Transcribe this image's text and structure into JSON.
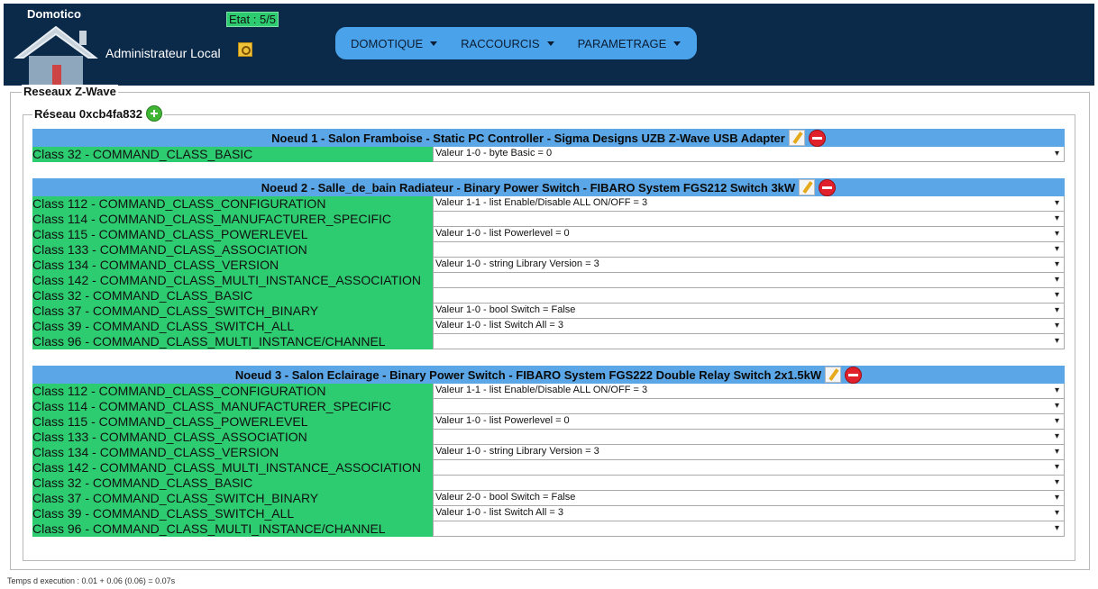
{
  "header": {
    "brand": "Domotico",
    "etat": "Etat : 5/5",
    "user": "Administrateur Local",
    "menu": [
      {
        "label": "DOMOTIQUE"
      },
      {
        "label": "RACCOURCIS"
      },
      {
        "label": "PARAMETRAGE"
      }
    ]
  },
  "section_title": "Reseaux Z-Wave",
  "network_title": "Réseau 0xcb4fa832",
  "nodes": [
    {
      "title": "Noeud 1 - Salon Framboise - Static PC Controller - Sigma Designs UZB Z-Wave USB Adapter",
      "rows": [
        {
          "cls": "Class 32 - COMMAND_CLASS_BASIC",
          "val": "Valeur 1-0 - byte Basic = 0"
        }
      ]
    },
    {
      "title": "Noeud 2 - Salle_de_bain Radiateur - Binary Power Switch - FIBARO System FGS212 Switch 3kW",
      "rows": [
        {
          "cls": "Class 112 - COMMAND_CLASS_CONFIGURATION",
          "val": "Valeur 1-1 - list Enable/Disable ALL ON/OFF = 3"
        },
        {
          "cls": "Class 114 - COMMAND_CLASS_MANUFACTURER_SPECIFIC",
          "val": ""
        },
        {
          "cls": "Class 115 - COMMAND_CLASS_POWERLEVEL",
          "val": "Valeur 1-0 - list Powerlevel = 0"
        },
        {
          "cls": "Class 133 - COMMAND_CLASS_ASSOCIATION",
          "val": ""
        },
        {
          "cls": "Class 134 - COMMAND_CLASS_VERSION",
          "val": "Valeur 1-0 - string Library Version = 3"
        },
        {
          "cls": "Class 142 - COMMAND_CLASS_MULTI_INSTANCE_ASSOCIATION",
          "val": ""
        },
        {
          "cls": "Class 32 - COMMAND_CLASS_BASIC",
          "val": ""
        },
        {
          "cls": "Class 37 - COMMAND_CLASS_SWITCH_BINARY",
          "val": "Valeur 1-0 - bool Switch = False"
        },
        {
          "cls": "Class 39 - COMMAND_CLASS_SWITCH_ALL",
          "val": "Valeur 1-0 - list Switch All = 3"
        },
        {
          "cls": "Class 96 - COMMAND_CLASS_MULTI_INSTANCE/CHANNEL",
          "val": ""
        }
      ]
    },
    {
      "title": "Noeud 3 - Salon Eclairage - Binary Power Switch - FIBARO System FGS222 Double Relay Switch 2x1.5kW",
      "rows": [
        {
          "cls": "Class 112 - COMMAND_CLASS_CONFIGURATION",
          "val": "Valeur 1-1 - list Enable/Disable ALL ON/OFF = 3"
        },
        {
          "cls": "Class 114 - COMMAND_CLASS_MANUFACTURER_SPECIFIC",
          "val": ""
        },
        {
          "cls": "Class 115 - COMMAND_CLASS_POWERLEVEL",
          "val": "Valeur 1-0 - list Powerlevel = 0"
        },
        {
          "cls": "Class 133 - COMMAND_CLASS_ASSOCIATION",
          "val": ""
        },
        {
          "cls": "Class 134 - COMMAND_CLASS_VERSION",
          "val": "Valeur 1-0 - string Library Version = 3"
        },
        {
          "cls": "Class 142 - COMMAND_CLASS_MULTI_INSTANCE_ASSOCIATION",
          "val": ""
        },
        {
          "cls": "Class 32 - COMMAND_CLASS_BASIC",
          "val": ""
        },
        {
          "cls": "Class 37 - COMMAND_CLASS_SWITCH_BINARY",
          "val": "Valeur 2-0 - bool Switch = False"
        },
        {
          "cls": "Class 39 - COMMAND_CLASS_SWITCH_ALL",
          "val": "Valeur 1-0 - list Switch All = 3"
        },
        {
          "cls": "Class 96 - COMMAND_CLASS_MULTI_INSTANCE/CHANNEL",
          "val": ""
        }
      ]
    }
  ],
  "footer": "Temps d execution : 0.01 + 0.06 (0.06) = 0.07s"
}
